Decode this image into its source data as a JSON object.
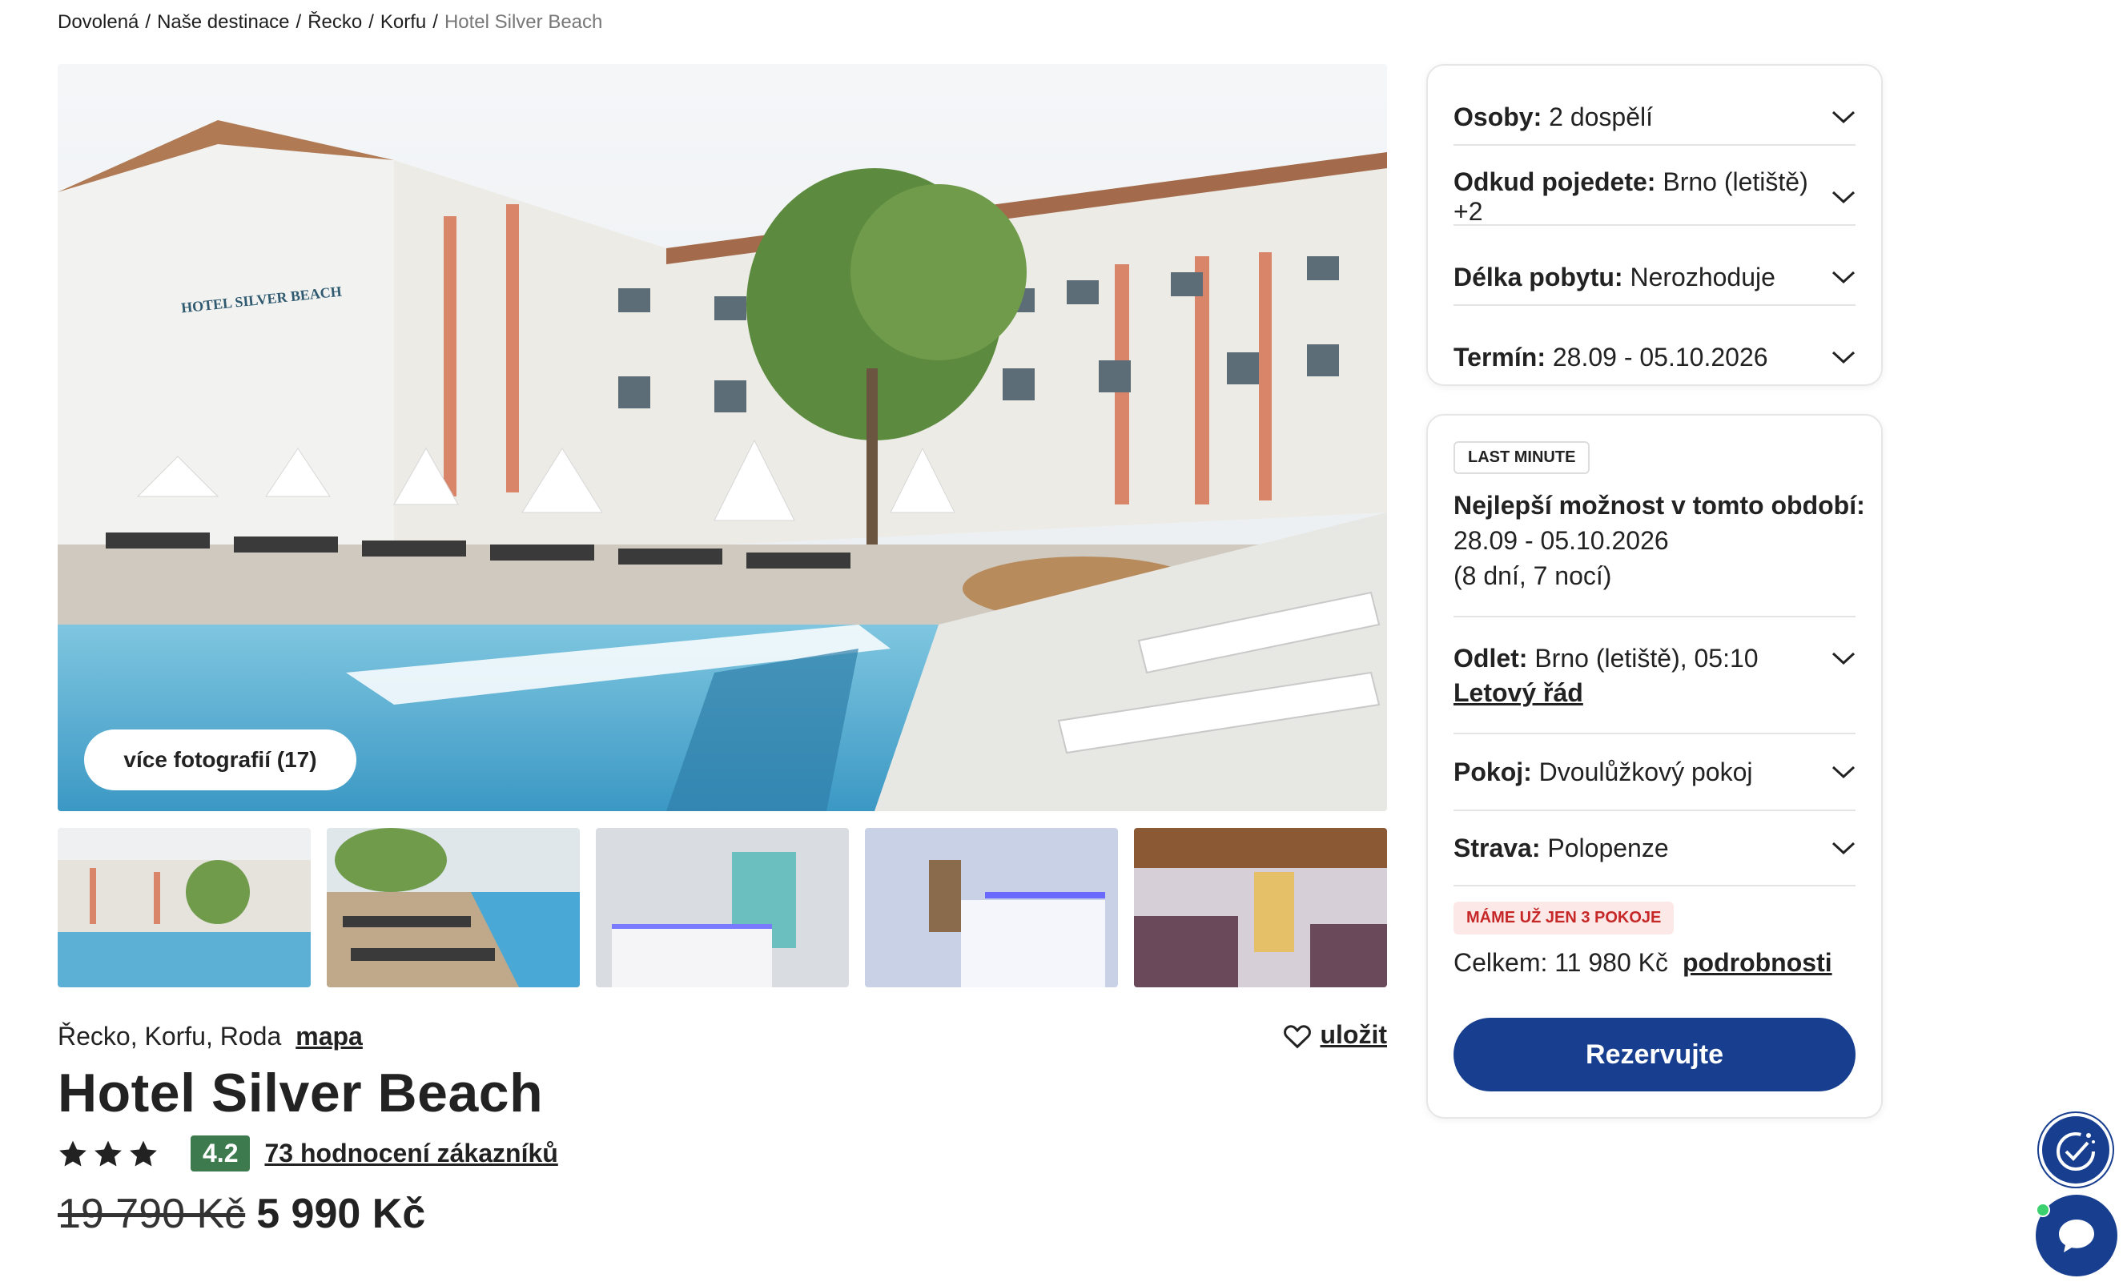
{
  "breadcrumb": [
    "Dovolená",
    "Naše destinace",
    "Řecko",
    "Korfu"
  ],
  "breadcrumb_current": "Hotel Silver Beach",
  "gallery": {
    "more_photos": "více fotografií (17)",
    "hotel_sign": "HOTEL SILVER BEACH"
  },
  "hotel": {
    "location": "Řecko, Korfu, Roda",
    "map_link": "mapa",
    "save": "uložit",
    "name": "Hotel Silver Beach",
    "stars": 3,
    "score": "4.2",
    "reviews": "73 hodnocení zákazníků",
    "old_price": "19 790 Kč",
    "price": "5 990 Kč"
  },
  "filters": [
    {
      "label": "Osoby:",
      "value": "2 dospělí"
    },
    {
      "label": "Odkud pojedete:",
      "value": "Brno (letiště) +2"
    },
    {
      "label": "Délka pobytu:",
      "value": "Nerozhoduje"
    },
    {
      "label": "Termín:",
      "value": "28.09 - 05.10.2026"
    }
  ],
  "offer": {
    "badge": "LAST MINUTE",
    "best_title": "Nejlepší možnost v tomto období:",
    "dates": "28.09 - 05.10.2026",
    "duration": "(8 dní, 7 nocí)",
    "flight_label": "Odlet:",
    "flight_value": "Brno (letiště), 05:10",
    "schedule_link": "Letový řád",
    "room_label": "Pokoj:",
    "room_value": "Dvoulůžkový pokoj",
    "board_label": "Strava:",
    "board_value": "Polopenze",
    "rooms_badge": "MÁME UŽ JEN 3 POKOJE",
    "total": "Celkem: 11 980 Kč",
    "details_link": "podrobnosti",
    "reserve": "Rezervujte"
  },
  "colors": {
    "brand": "#183f8f",
    "score": "#3d7a4e",
    "alert": "#c62828"
  }
}
